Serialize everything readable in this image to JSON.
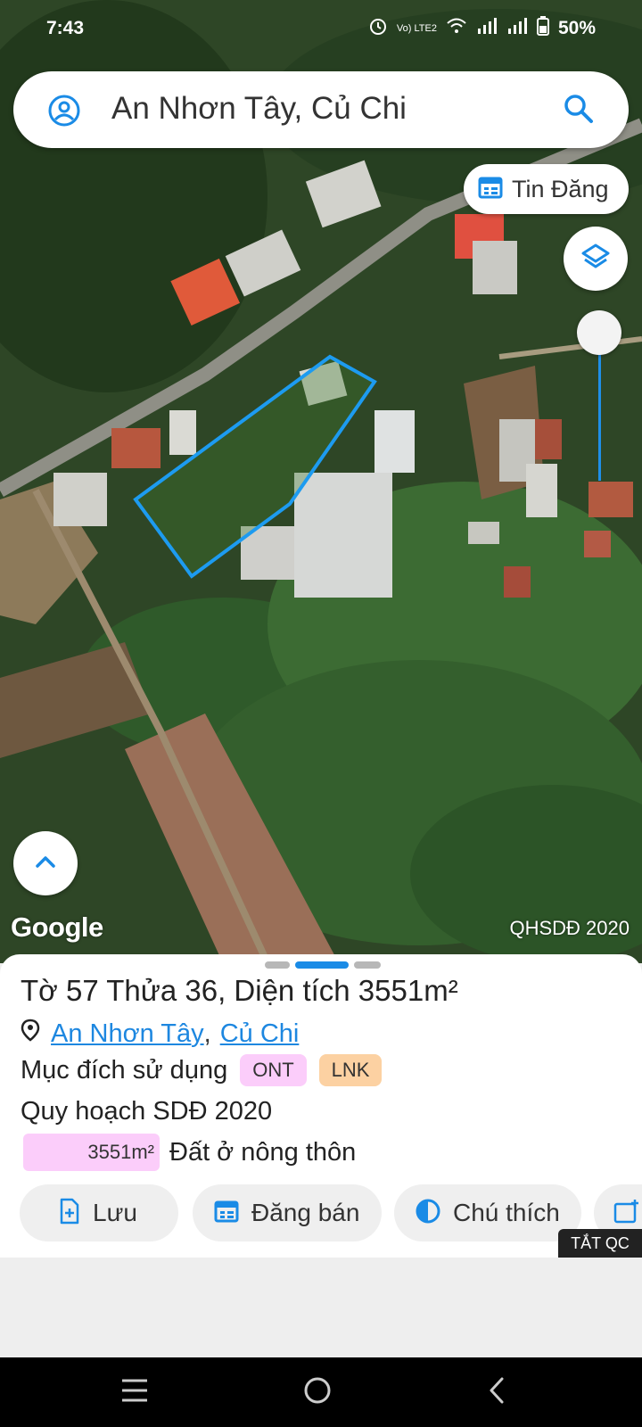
{
  "status_bar": {
    "time": "7:43",
    "network": "Vo) LTE2",
    "battery": "50%"
  },
  "search": {
    "query": "An Nhơn Tây, Củ Chi"
  },
  "map_controls": {
    "tin_dang_label": "Tin Đăng"
  },
  "map_footer": {
    "google_logo": "Google",
    "layer_label": "QHSDĐ 2020"
  },
  "sheet": {
    "title": "Tờ 57 Thửa 36, Diện tích 3551m²",
    "location": {
      "commune": "An Nhơn Tây",
      "separator": ",",
      "district": "Củ Chi"
    },
    "purpose_label": "Mục đích sử dụng",
    "purpose_tags": [
      "ONT",
      "LNK"
    ],
    "plan_label": "Quy hoạch SDĐ 2020",
    "land_use": {
      "area": "3551m²",
      "type": "Đất ở nông thôn"
    },
    "actions": [
      "Lưu",
      "Đăng bán",
      "Chú thích"
    ]
  },
  "ad_toggle": "TẮT QC",
  "colors": {
    "accent": "#1a8be6",
    "ont": "#fbcdfa",
    "lnk": "#fcd1a2",
    "parcel_outline": "#1d9bf0"
  }
}
